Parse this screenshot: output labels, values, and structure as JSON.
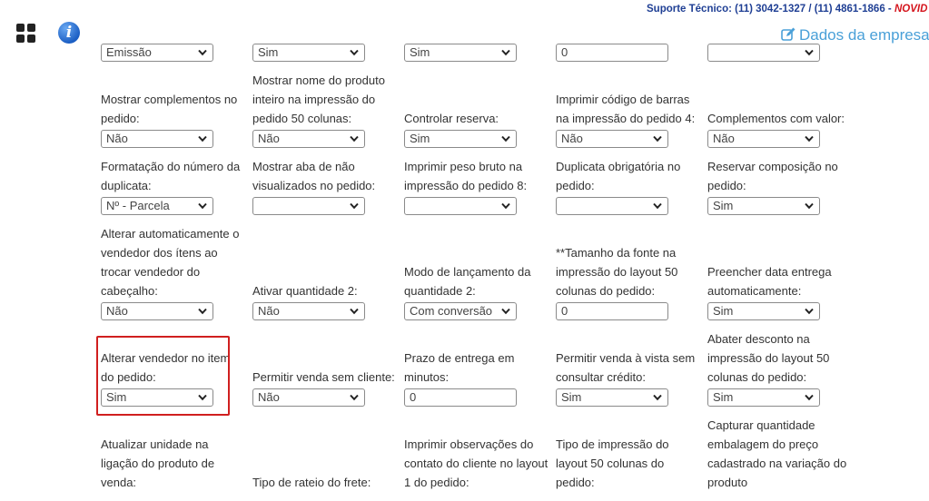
{
  "header": {
    "support_text": "Suporte Técnico: (11) 3042-1327 / (11) 4861-1866 - ",
    "support_new": "NOVID",
    "company_link": "Dados da empresa",
    "accent_color": "#4aa0d8",
    "support_color": "#1f3f94",
    "highlight_color": "#d01f1f"
  },
  "rows": [
    [
      {
        "label": "",
        "type": "select",
        "value": "Emissão"
      },
      {
        "label": "",
        "type": "select",
        "value": "Sim"
      },
      {
        "label": "",
        "type": "select",
        "value": "Sim"
      },
      {
        "label": "",
        "type": "input",
        "value": "0"
      },
      {
        "label": "",
        "type": "select",
        "value": ""
      }
    ],
    [
      {
        "label": "Mostrar complementos no pedido:",
        "type": "select",
        "value": "Não"
      },
      {
        "label": "Mostrar nome do produto inteiro na impressão do pedido 50 colunas:",
        "type": "select",
        "value": "Não"
      },
      {
        "label": "Controlar reserva:",
        "type": "select",
        "value": "Sim"
      },
      {
        "label": "Imprimir código de barras na impressão do pedido 4:",
        "type": "select",
        "value": "Não"
      },
      {
        "label": "Complementos com valor:",
        "type": "select",
        "value": "Não"
      }
    ],
    [
      {
        "label": "Formatação do número da duplicata:",
        "type": "select",
        "value": "Nº - Parcela"
      },
      {
        "label": "Mostrar aba de não visualizados no pedido:",
        "type": "select",
        "value": ""
      },
      {
        "label": "Imprimir peso bruto na impressão do pedido 8:",
        "type": "select",
        "value": ""
      },
      {
        "label": "Duplicata obrigatória no pedido:",
        "type": "select",
        "value": ""
      },
      {
        "label": "Reservar composição no pedido:",
        "type": "select",
        "value": "Sim"
      }
    ],
    [
      {
        "label": "Alterar automaticamente o vendedor dos ítens ao trocar vendedor do cabeçalho:",
        "type": "select",
        "value": "Não"
      },
      {
        "label": "Ativar quantidade 2:",
        "type": "select",
        "value": "Não"
      },
      {
        "label": "Modo de lançamento da quantidade 2:",
        "type": "select",
        "value": "Com conversão"
      },
      {
        "label": "**Tamanho da fonte na impressão do layout 50 colunas do pedido:",
        "type": "input",
        "value": "0"
      },
      {
        "label": "Preencher data entrega automaticamente:",
        "type": "select",
        "value": "Sim"
      }
    ],
    [
      {
        "label": "Alterar vendedor no item do pedido:",
        "type": "select",
        "value": "Sim"
      },
      {
        "label": "Permitir venda sem cliente:",
        "type": "select",
        "value": "Não"
      },
      {
        "label": "Prazo de entrega em minutos:",
        "type": "input",
        "value": "0"
      },
      {
        "label": "Permitir venda à vista sem consultar crédito:",
        "type": "select",
        "value": "Sim"
      },
      {
        "label": "Abater desconto na impressão do layout 50 colunas do pedido:",
        "type": "select",
        "value": "Sim"
      }
    ],
    [
      {
        "label": "Atualizar unidade na ligação do produto de venda:",
        "type": "none",
        "value": ""
      },
      {
        "label": "Tipo de rateio do frete:",
        "type": "none",
        "value": ""
      },
      {
        "label": "Imprimir observações do contato do cliente no layout 1 do pedido:",
        "type": "none",
        "value": ""
      },
      {
        "label": "Tipo de impressão do layout 50 colunas do pedido:",
        "type": "none",
        "value": ""
      },
      {
        "label": "Capturar quantidade embalagem do preço cadastrado na variação do produto",
        "type": "none",
        "value": ""
      }
    ]
  ]
}
